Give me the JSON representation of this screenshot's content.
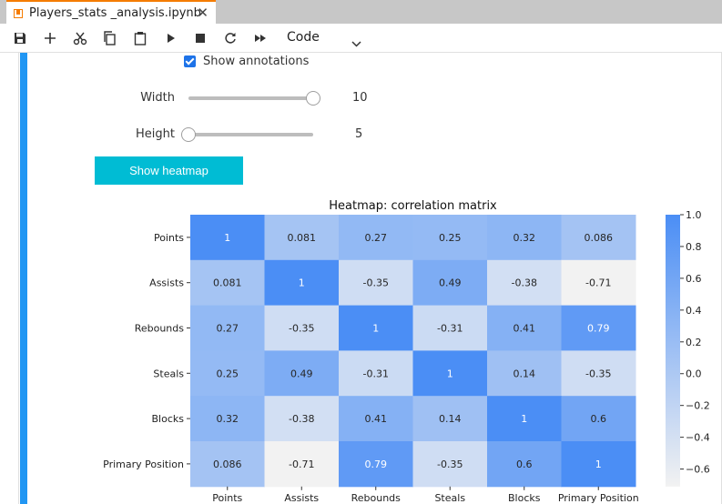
{
  "tab": {
    "title": "Players_stats _analysis.ipynb",
    "close": "✕"
  },
  "toolbar": {
    "icons": [
      "save-icon",
      "add-icon",
      "cut-icon",
      "copy-icon",
      "paste-icon",
      "run-icon",
      "stop-icon",
      "restart-icon",
      "fast-forward-icon"
    ],
    "cell_type": "Code"
  },
  "widgets": {
    "annotations_label": "Show annotations",
    "annotations_checked": true,
    "width": {
      "label": "Width",
      "value": "10",
      "fraction": 1.0
    },
    "height": {
      "label": "Height",
      "value": "5",
      "fraction": 0.0
    },
    "button_label": "Show heatmap"
  },
  "chart_data": {
    "type": "heatmap",
    "title": "Heatmap: correlation matrix",
    "rows": [
      "Points",
      "Assists",
      "Rebounds",
      "Steals",
      "Blocks",
      "Primary Position"
    ],
    "columns": [
      "Points",
      "Assists",
      "Rebounds",
      "Steals",
      "Blocks",
      "Primary Position"
    ],
    "values": [
      [
        1,
        0.081,
        0.27,
        0.25,
        0.32,
        0.086
      ],
      [
        0.081,
        1,
        -0.35,
        0.49,
        -0.38,
        -0.71
      ],
      [
        0.27,
        -0.35,
        1,
        -0.31,
        0.41,
        0.79
      ],
      [
        0.25,
        0.49,
        -0.31,
        1,
        0.14,
        -0.35
      ],
      [
        0.32,
        -0.38,
        0.41,
        0.14,
        1,
        0.6
      ],
      [
        0.086,
        -0.71,
        0.79,
        -0.35,
        0.6,
        1
      ]
    ],
    "labels": [
      [
        "1",
        "0.081",
        "0.27",
        "0.25",
        "0.32",
        "0.086"
      ],
      [
        "0.081",
        "1",
        "-0.35",
        "0.49",
        "-0.38",
        "-0.71"
      ],
      [
        "0.27",
        "-0.35",
        "1",
        "-0.31",
        "0.41",
        "0.79"
      ],
      [
        "0.25",
        "0.49",
        "-0.31",
        "1",
        "0.14",
        "-0.35"
      ],
      [
        "0.32",
        "-0.38",
        "0.41",
        "0.14",
        "1",
        "0.6"
      ],
      [
        "0.086",
        "-0.71",
        "0.79",
        "-0.35",
        "0.6",
        "1"
      ]
    ],
    "colorbar": {
      "range": [
        -0.71,
        1.0
      ],
      "ticks": [
        1.0,
        0.8,
        0.6,
        0.4,
        0.2,
        0.0,
        -0.2,
        -0.4,
        -0.6
      ],
      "tick_labels": [
        "1.0",
        "0.8",
        "0.6",
        "0.4",
        "0.2",
        "0.0",
        "−0.2",
        "−0.4",
        "−0.6"
      ],
      "color_low": "#f2f2f2",
      "color_high": "#4b8ef5"
    }
  }
}
